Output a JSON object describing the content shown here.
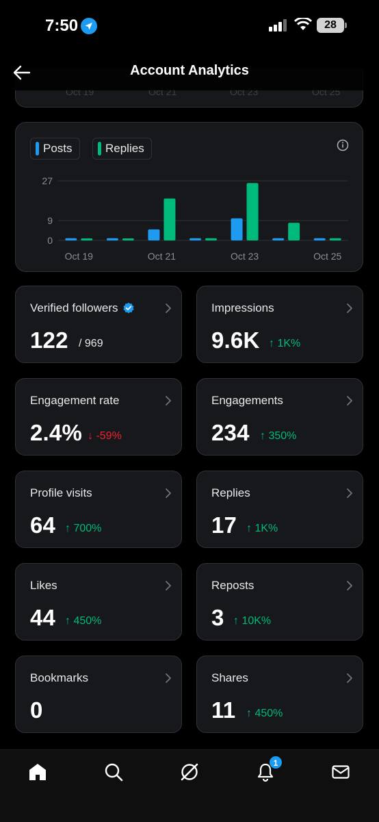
{
  "status_bar": {
    "time": "7:50",
    "battery": "28"
  },
  "header": {
    "title": "Account Analytics"
  },
  "previous_chart": {
    "x_labels": [
      "Oct 19",
      "Oct 21",
      "Oct 23",
      "Oct 25"
    ]
  },
  "chart_data": {
    "type": "bar",
    "categories": [
      "Oct 19",
      "Oct 20",
      "Oct 21",
      "Oct 22",
      "Oct 23",
      "Oct 24",
      "Oct 25"
    ],
    "x_tick_labels": [
      "Oct 19",
      "Oct 21",
      "Oct 23",
      "Oct 25"
    ],
    "y_ticks": [
      "27",
      "9",
      "0"
    ],
    "ylim": [
      0,
      27
    ],
    "grid": true,
    "legend_position": "top-left",
    "series": [
      {
        "name": "Posts",
        "color": "#1d9bf0",
        "values": [
          1,
          1,
          5,
          1,
          10,
          1,
          1
        ]
      },
      {
        "name": "Replies",
        "color": "#00ba7c",
        "values": [
          0,
          0,
          19,
          1,
          26,
          8,
          1
        ]
      }
    ]
  },
  "metrics": [
    {
      "label": "Verified followers",
      "value": "122",
      "sub": "/ 969",
      "change": "",
      "direction": "none",
      "verified": true
    },
    {
      "label": "Impressions",
      "value": "9.6K",
      "sub": "",
      "change": "1K%",
      "direction": "up",
      "verified": false
    },
    {
      "label": "Engagement rate",
      "value": "2.4%",
      "sub": "",
      "change": "-59%",
      "direction": "down",
      "verified": false
    },
    {
      "label": "Engagements",
      "value": "234",
      "sub": "",
      "change": "350%",
      "direction": "up",
      "verified": false
    },
    {
      "label": "Profile visits",
      "value": "64",
      "sub": "",
      "change": "700%",
      "direction": "up",
      "verified": false
    },
    {
      "label": "Replies",
      "value": "17",
      "sub": "",
      "change": "1K%",
      "direction": "up",
      "verified": false
    },
    {
      "label": "Likes",
      "value": "44",
      "sub": "",
      "change": "450%",
      "direction": "up",
      "verified": false
    },
    {
      "label": "Reposts",
      "value": "3",
      "sub": "",
      "change": "10K%",
      "direction": "up",
      "verified": false
    },
    {
      "label": "Bookmarks",
      "value": "0",
      "sub": "",
      "change": "",
      "direction": "none",
      "verified": false
    },
    {
      "label": "Shares",
      "value": "11",
      "sub": "",
      "change": "450%",
      "direction": "up",
      "verified": false
    }
  ],
  "colors": {
    "up": "#00ba7c",
    "down": "#f4212e",
    "accent": "#1d9bf0"
  },
  "tab_bar": {
    "items": [
      {
        "icon": "home-icon"
      },
      {
        "icon": "search-icon"
      },
      {
        "icon": "grok-icon"
      },
      {
        "icon": "bell-icon"
      },
      {
        "icon": "mail-icon"
      }
    ],
    "notification_badge": "1"
  }
}
